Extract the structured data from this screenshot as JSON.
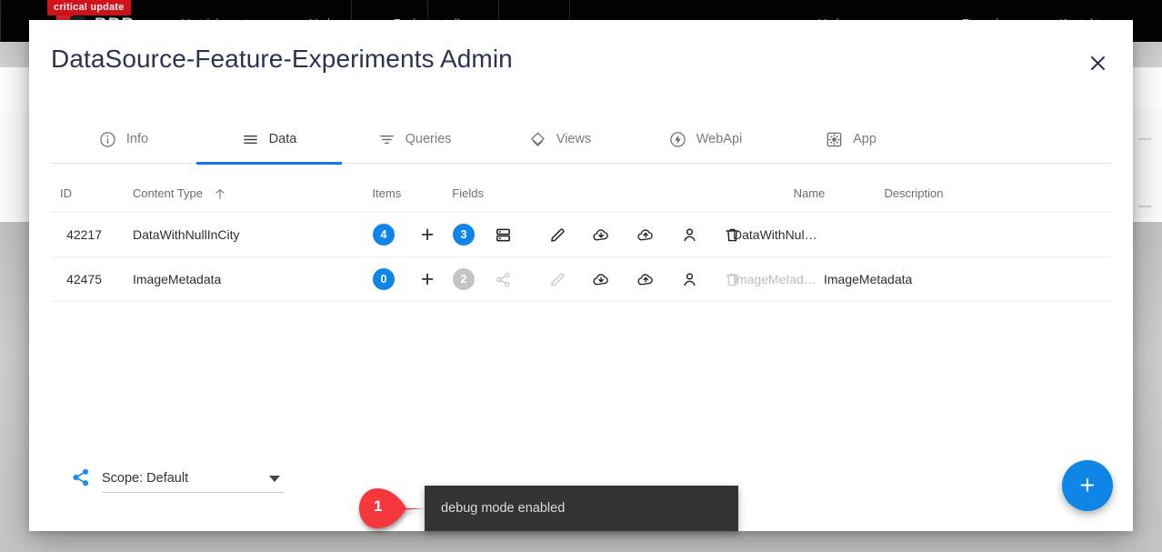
{
  "background": {
    "badge_label": "critical update",
    "wordmark": "BBB",
    "nav_links": [
      "Vertriebspartner",
      "Verlage",
      "Fachausstellung"
    ],
    "nav_links_right": [
      "Verlagsprogramme",
      "Formulare",
      "Kontakt"
    ]
  },
  "modal": {
    "title": "DataSource-Feature-Experiments Admin",
    "close_label": "×",
    "tabs": [
      {
        "label": "Info",
        "icon": "info-icon",
        "active": false
      },
      {
        "label": "Data",
        "icon": "list-icon",
        "active": true
      },
      {
        "label": "Queries",
        "icon": "filter-icon",
        "active": false
      },
      {
        "label": "Views",
        "icon": "layers-icon",
        "active": false
      },
      {
        "label": "WebApi",
        "icon": "flash-icon",
        "active": false
      },
      {
        "label": "App",
        "icon": "settings-icon",
        "active": false
      }
    ]
  },
  "table": {
    "headers": {
      "id": "ID",
      "content_type": "Content Type",
      "sort_indicator": "↑",
      "items": "Items",
      "fields": "Fields",
      "name": "Name",
      "description": "Description"
    },
    "rows": [
      {
        "id": "42217",
        "content_type": "DataWithNullInCity",
        "items_count": "4",
        "items_enabled": true,
        "fields_count": "3",
        "fields_enabled": true,
        "third_icon": "layout-rows-icon",
        "third_icon_enabled": true,
        "edit_enabled": true,
        "import_enabled": true,
        "export_enabled": true,
        "permissions_enabled": true,
        "delete_enabled": true,
        "name": "DataWithNul…",
        "name_muted": false,
        "description": ""
      },
      {
        "id": "42475",
        "content_type": "ImageMetadata",
        "items_count": "0",
        "items_enabled": true,
        "fields_count": "2",
        "fields_enabled": false,
        "third_icon": "share-icon",
        "third_icon_enabled": false,
        "edit_enabled": false,
        "import_enabled": true,
        "export_enabled": true,
        "permissions_enabled": true,
        "delete_enabled": false,
        "name": "ImageMetad…",
        "name_muted": true,
        "description": "ImageMetadata"
      }
    ]
  },
  "footer": {
    "scope_icon": "share-icon",
    "scope_label": "Scope: Default",
    "fab_label": "+",
    "fab_icon": "plus-icon"
  },
  "toast": {
    "message": "debug mode enabled"
  },
  "annotation": {
    "marker_number": "1"
  },
  "colors": {
    "accent_blue": "#1085e8",
    "tab_active_blue": "#1976f0",
    "title_navy": "#2c3350",
    "toast_bg": "#333333",
    "marker_red": "#f5383c",
    "badge_red": "#d8131a",
    "disabled_grey": "#c4c4c4"
  }
}
